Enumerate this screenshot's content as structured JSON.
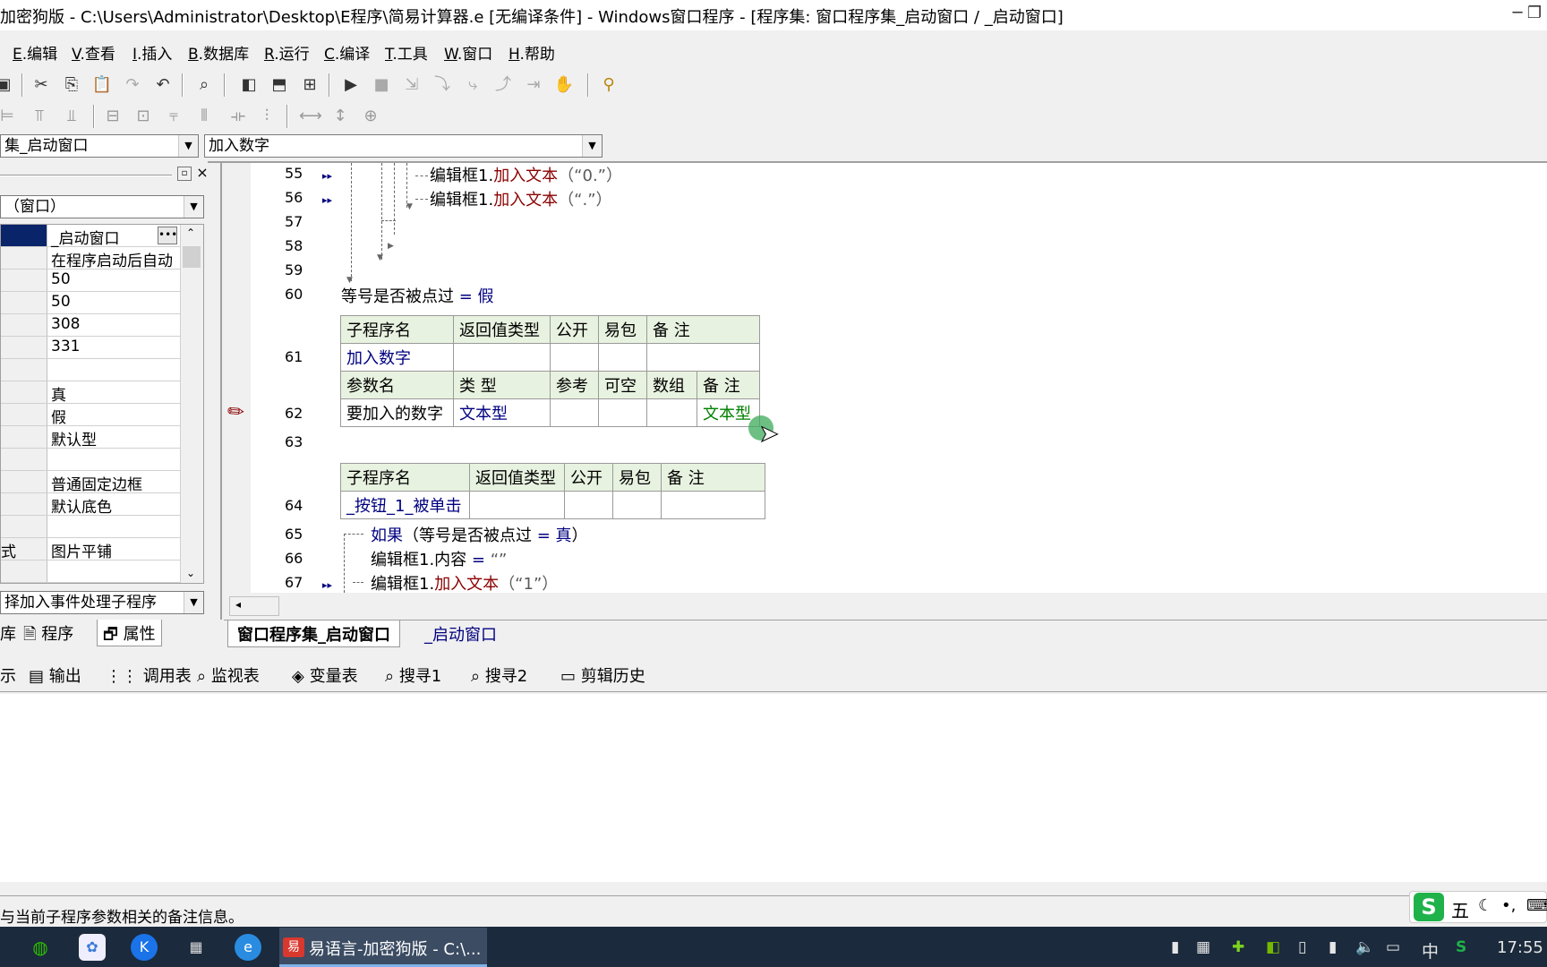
{
  "window": {
    "title": "加密狗版 - C:\\Users\\Administrator\\Desktop\\E程序\\简易计算器.e [无编译条件] - Windows窗口程序 - [程序集: 窗口程序集_启动窗口 / _启动窗口]",
    "min": "─",
    "max": "❐"
  },
  "menu": [
    {
      "key": "E",
      "label": ".编辑"
    },
    {
      "key": "V",
      "label": ".查看"
    },
    {
      "key": "I",
      "label": ".插入"
    },
    {
      "key": "B",
      "label": ".数据库"
    },
    {
      "key": "R",
      "label": ".运行"
    },
    {
      "key": "C",
      "label": ".编译"
    },
    {
      "key": "T",
      "label": ".工具"
    },
    {
      "key": "W",
      "label": ".窗口"
    },
    {
      "key": "H",
      "label": ".帮助"
    }
  ],
  "combos": {
    "assembly": "集_启动窗口",
    "subprogram": "加入数字",
    "object": "（窗口）",
    "event": "择加入事件处理子程序"
  },
  "properties": {
    "values": [
      "_启动窗口",
      "在程序启动后自动",
      "50",
      "50",
      "308",
      "331",
      "",
      "真",
      "假",
      "默认型",
      "",
      "普通固定边框",
      "默认底色",
      "",
      "图片平铺",
      ""
    ],
    "last_name_fragment": "式"
  },
  "left_tabs": {
    "t0": "库",
    "t1": "程序",
    "t2": "属性"
  },
  "code": {
    "l55": {
      "num": "55",
      "obj": "编辑框1.",
      "method": "加入文本",
      "arg": "（“0.”）"
    },
    "l56": {
      "num": "56",
      "obj": "编辑框1.",
      "method": "加入文本",
      "arg": "（“.”）"
    },
    "l57": {
      "num": "57"
    },
    "l58": {
      "num": "58"
    },
    "l59": {
      "num": "59"
    },
    "l60": {
      "num": "60",
      "text": "等号是否被点过",
      "eq": " = ",
      "val": "假"
    },
    "l61": {
      "num": "61"
    },
    "l62": {
      "num": "62"
    },
    "l63": {
      "num": "63"
    },
    "l64": {
      "num": "64"
    },
    "l65": {
      "num": "65",
      "kw": "如果",
      "cond": "（等号是否被点过",
      "eq": " = ",
      "val": "真",
      "close": "）"
    },
    "l66": {
      "num": "66",
      "text": "编辑框1.内容",
      "eq": " = ",
      "val": "“”"
    },
    "l67": {
      "num": "67",
      "obj": "编辑框1.",
      "method": "加入文本",
      "arg": "（“1”）"
    }
  },
  "sub1": {
    "headers": [
      "子程序名",
      "返回值类型",
      "公开",
      "易包",
      "备 注"
    ],
    "name": "加入数字",
    "param_headers": [
      "参数名",
      "类 型",
      "参考",
      "可空",
      "数组",
      "备 注"
    ],
    "param_name": "要加入的数字",
    "param_type": "文本型",
    "param_note": "文本型"
  },
  "sub2": {
    "headers": [
      "子程序名",
      "返回值类型",
      "公开",
      "易包",
      "备 注"
    ],
    "name": "_按钮_1_被单击"
  },
  "editor_tabs": {
    "t1": "窗口程序集_启动窗口",
    "t2": "_启动窗口"
  },
  "bottom_tabs": {
    "t0": "示",
    "t1": "输出",
    "t2": "调用表",
    "t3": "监视表",
    "t4": "变量表",
    "t5": "搜寻1",
    "t6": "搜寻2",
    "t7": "剪辑历史"
  },
  "status": "与当前子程序参数相关的备注信息。",
  "ime": {
    "logo": "S",
    "mode": "五"
  },
  "taskbar": {
    "app": "易语言-加密狗版 - C:\\...",
    "lang": "中",
    "time": "17:55"
  },
  "colors": {
    "keyword_red": "#8b0000",
    "type_blue": "#000080",
    "note_green": "#008000",
    "table_header": "#e8f2e0",
    "taskbar": "#1b2a3c"
  }
}
